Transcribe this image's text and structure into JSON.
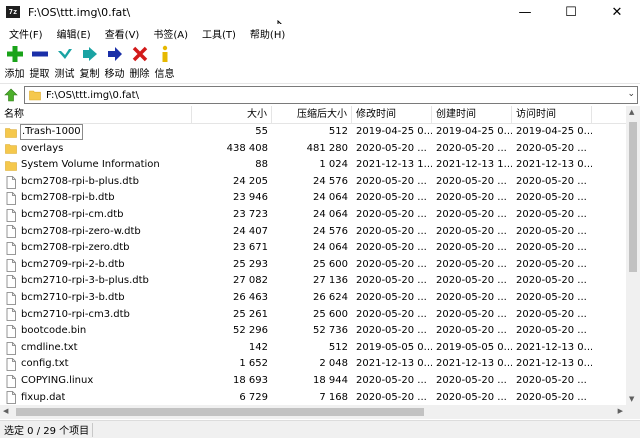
{
  "window": {
    "app_icon_text": "7z",
    "title": "F:\\OS\\ttt.img\\0.fat\\",
    "controls": {
      "minimize": "—",
      "maximize": "☐",
      "close": "✕"
    }
  },
  "menu": [
    "文件(F)",
    "编辑(E)",
    "查看(V)",
    "书签(A)",
    "工具(T)",
    "帮助(H)"
  ],
  "toolbar": [
    {
      "label": "添加",
      "icon": "plus-icon",
      "color": "#1aa31a"
    },
    {
      "label": "提取",
      "icon": "minus-icon",
      "color": "#1a2fa8"
    },
    {
      "label": "测试",
      "icon": "check-icon",
      "color": "#1aa3a3"
    },
    {
      "label": "复制",
      "icon": "double-arrow-right-icon",
      "color": "#1aa3a3"
    },
    {
      "label": "移动",
      "icon": "arrow-right-icon",
      "color": "#1a2fa8"
    },
    {
      "label": "删除",
      "icon": "x-icon",
      "color": "#d21a1a"
    },
    {
      "label": "信息",
      "icon": "info-icon",
      "color": "#e6b800"
    }
  ],
  "address": {
    "path": "F:\\OS\\ttt.img\\0.fat\\"
  },
  "columns": {
    "name": "名称",
    "size": "大小",
    "packed": "压缩后大小",
    "modified": "修改时间",
    "created": "创建时间",
    "accessed": "访问时间"
  },
  "files": [
    {
      "name": ".Trash-1000",
      "type": "folder",
      "size": "55",
      "packed": "512",
      "modified": "2019-04-25 0...",
      "created": "2019-04-25 0...",
      "accessed": "2019-04-25 0...",
      "focused": true
    },
    {
      "name": "overlays",
      "type": "folder",
      "size": "438 408",
      "packed": "481 280",
      "modified": "2020-05-20 ...",
      "created": "2020-05-20 ...",
      "accessed": "2020-05-20 ..."
    },
    {
      "name": "System Volume Information",
      "type": "folder",
      "size": "88",
      "packed": "1 024",
      "modified": "2021-12-13 1...",
      "created": "2021-12-13 1...",
      "accessed": "2021-12-13 0..."
    },
    {
      "name": "bcm2708-rpi-b-plus.dtb",
      "type": "file",
      "size": "24 205",
      "packed": "24 576",
      "modified": "2020-05-20 ...",
      "created": "2020-05-20 ...",
      "accessed": "2020-05-20 ..."
    },
    {
      "name": "bcm2708-rpi-b.dtb",
      "type": "file",
      "size": "23 946",
      "packed": "24 064",
      "modified": "2020-05-20 ...",
      "created": "2020-05-20 ...",
      "accessed": "2020-05-20 ..."
    },
    {
      "name": "bcm2708-rpi-cm.dtb",
      "type": "file",
      "size": "23 723",
      "packed": "24 064",
      "modified": "2020-05-20 ...",
      "created": "2020-05-20 ...",
      "accessed": "2020-05-20 ..."
    },
    {
      "name": "bcm2708-rpi-zero-w.dtb",
      "type": "file",
      "size": "24 407",
      "packed": "24 576",
      "modified": "2020-05-20 ...",
      "created": "2020-05-20 ...",
      "accessed": "2020-05-20 ..."
    },
    {
      "name": "bcm2708-rpi-zero.dtb",
      "type": "file",
      "size": "23 671",
      "packed": "24 064",
      "modified": "2020-05-20 ...",
      "created": "2020-05-20 ...",
      "accessed": "2020-05-20 ..."
    },
    {
      "name": "bcm2709-rpi-2-b.dtb",
      "type": "file",
      "size": "25 293",
      "packed": "25 600",
      "modified": "2020-05-20 ...",
      "created": "2020-05-20 ...",
      "accessed": "2020-05-20 ..."
    },
    {
      "name": "bcm2710-rpi-3-b-plus.dtb",
      "type": "file",
      "size": "27 082",
      "packed": "27 136",
      "modified": "2020-05-20 ...",
      "created": "2020-05-20 ...",
      "accessed": "2020-05-20 ..."
    },
    {
      "name": "bcm2710-rpi-3-b.dtb",
      "type": "file",
      "size": "26 463",
      "packed": "26 624",
      "modified": "2020-05-20 ...",
      "created": "2020-05-20 ...",
      "accessed": "2020-05-20 ..."
    },
    {
      "name": "bcm2710-rpi-cm3.dtb",
      "type": "file",
      "size": "25 261",
      "packed": "25 600",
      "modified": "2020-05-20 ...",
      "created": "2020-05-20 ...",
      "accessed": "2020-05-20 ..."
    },
    {
      "name": "bootcode.bin",
      "type": "file",
      "size": "52 296",
      "packed": "52 736",
      "modified": "2020-05-20 ...",
      "created": "2020-05-20 ...",
      "accessed": "2020-05-20 ..."
    },
    {
      "name": "cmdline.txt",
      "type": "file",
      "size": "142",
      "packed": "512",
      "modified": "2019-05-05 0...",
      "created": "2019-05-05 0...",
      "accessed": "2021-12-13 0..."
    },
    {
      "name": "config.txt",
      "type": "file",
      "size": "1 652",
      "packed": "2 048",
      "modified": "2021-12-13 0...",
      "created": "2021-12-13 0...",
      "accessed": "2021-12-13 0..."
    },
    {
      "name": "COPYING.linux",
      "type": "file",
      "size": "18 693",
      "packed": "18 944",
      "modified": "2020-05-20 ...",
      "created": "2020-05-20 ...",
      "accessed": "2020-05-20 ..."
    },
    {
      "name": "fixup.dat",
      "type": "file",
      "size": "6 729",
      "packed": "7 168",
      "modified": "2020-05-20 ...",
      "created": "2020-05-20 ...",
      "accessed": "2020-05-20 ..."
    }
  ],
  "status": {
    "text": "选定 0 / 29 个项目"
  },
  "colors": {
    "folder": "#f5c84c",
    "folder_dark": "#dcab2e",
    "selection_outline": "#8a8a8a"
  }
}
